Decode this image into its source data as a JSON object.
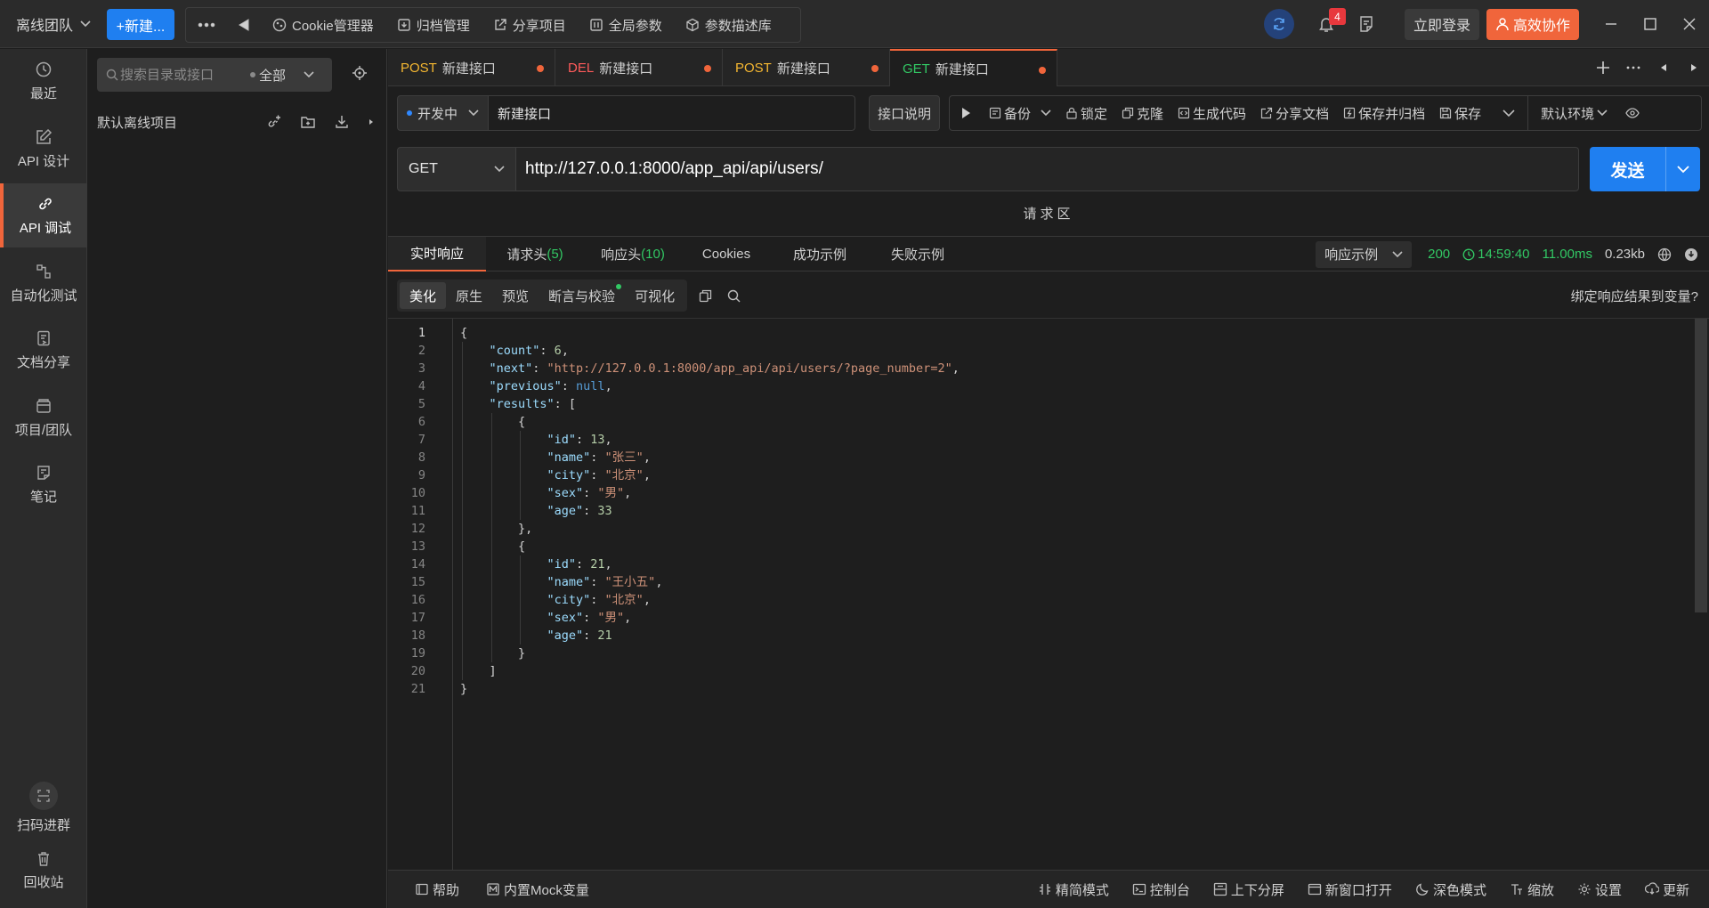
{
  "topbar": {
    "team": "离线团队",
    "new_label": "+新建...",
    "tools": [
      "Cookie管理器",
      "归档管理",
      "分享项目",
      "全局参数",
      "参数描述库"
    ],
    "notification_count": "4",
    "login": "立即登录",
    "collab": "高效协作"
  },
  "leftnav": {
    "items": [
      "最近",
      "API 设计",
      "API 调试",
      "自动化测试",
      "文档分享",
      "项目/团队",
      "笔记"
    ],
    "scan": "扫码进群",
    "trash": "回收站"
  },
  "dir": {
    "search_placeholder": "搜索目录或接口",
    "filter": "全部",
    "project": "默认离线项目"
  },
  "tabs": [
    {
      "method": "POST",
      "name": "新建接口",
      "color": "#f5b731"
    },
    {
      "method": "DEL",
      "name": "新建接口",
      "color": "#ff5a5a"
    },
    {
      "method": "POST",
      "name": "新建接口",
      "color": "#f5b731"
    },
    {
      "method": "GET",
      "name": "新建接口",
      "color": "#32c864"
    }
  ],
  "api": {
    "status": "开发中",
    "name": "新建接口",
    "desc_button": "接口说明",
    "actions": [
      "备份",
      "锁定",
      "克隆",
      "生成代码",
      "分享文档",
      "保存并归档",
      "保存"
    ],
    "env": "默认环境",
    "method": "GET",
    "url": "http://127.0.0.1:8000/app_api/api/users/",
    "send": "发送",
    "request_area": "请求区"
  },
  "response": {
    "tabs": {
      "live": "实时响应",
      "req_headers": "请求头",
      "req_headers_count": "(5)",
      "resp_headers": "响应头",
      "resp_headers_count": "(10)",
      "cookies": "Cookies",
      "success": "成功示例",
      "fail": "失败示例"
    },
    "example_select": "响应示例",
    "status": "200",
    "time": "14:59:40",
    "duration": "11.00ms",
    "size": "0.23kb",
    "subtabs": [
      "美化",
      "原生",
      "预览",
      "断言与校验",
      "可视化"
    ],
    "bind_link": "绑定响应结果到变量?"
  },
  "body_json": {
    "count": 6,
    "next": "http://127.0.0.1:8000/app_api/api/users/?page_number=2",
    "previous": null,
    "results": [
      {
        "id": 13,
        "name": "张三",
        "city": "北京",
        "sex": "男",
        "age": 33
      },
      {
        "id": 21,
        "name": "王小五",
        "city": "北京",
        "sex": "男",
        "age": 21
      }
    ]
  },
  "footer": {
    "left": [
      "帮助",
      "内置Mock变量"
    ],
    "right": [
      "精简模式",
      "控制台",
      "上下分屏",
      "新窗口打开",
      "深色模式",
      "缩放",
      "设置",
      "更新"
    ]
  },
  "colors": {
    "accent": "#f0653b",
    "primary": "#1f7ff0",
    "success": "#32c864"
  }
}
